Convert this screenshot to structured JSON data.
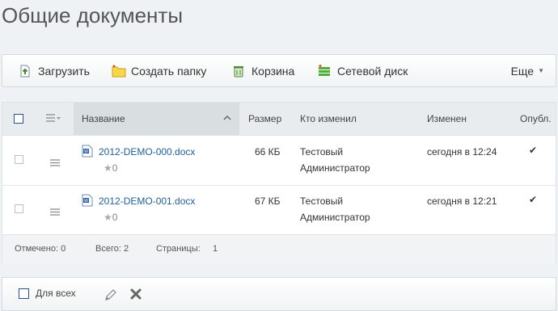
{
  "page": {
    "title": "Общие документы"
  },
  "toolbar": {
    "upload_label": "Загрузить",
    "create_folder_label": "Создать папку",
    "trash_label": "Корзина",
    "network_drive_label": "Сетевой диск",
    "more_label": "Еще"
  },
  "table": {
    "columns": {
      "name": "Название",
      "size": "Размер",
      "modified_by": "Кто изменил",
      "modified": "Изменен",
      "published": "Опубл."
    },
    "rows": [
      {
        "name": "2012-DEMO-000.docx",
        "rating": "0",
        "size": "66 КБ",
        "modified_by_line1": "Тестовый",
        "modified_by_line2": "Администратор",
        "modified": "сегодня в 12:24",
        "published": "✔"
      },
      {
        "name": "2012-DEMO-001.docx",
        "rating": "0",
        "size": "67 КБ",
        "modified_by_line1": "Тестовый",
        "modified_by_line2": "Администратор",
        "modified": "сегодня в 12:21",
        "published": "✔"
      }
    ],
    "footer": {
      "selected": "Отмечено: 0",
      "total": "Всего: 2",
      "pages": "Страницы:",
      "page_number": "1"
    }
  },
  "actions": {
    "for_all_label": "Для всех"
  },
  "colors": {
    "link": "#1d5f9e",
    "checkmark": "#333333",
    "delete": "#666666"
  }
}
